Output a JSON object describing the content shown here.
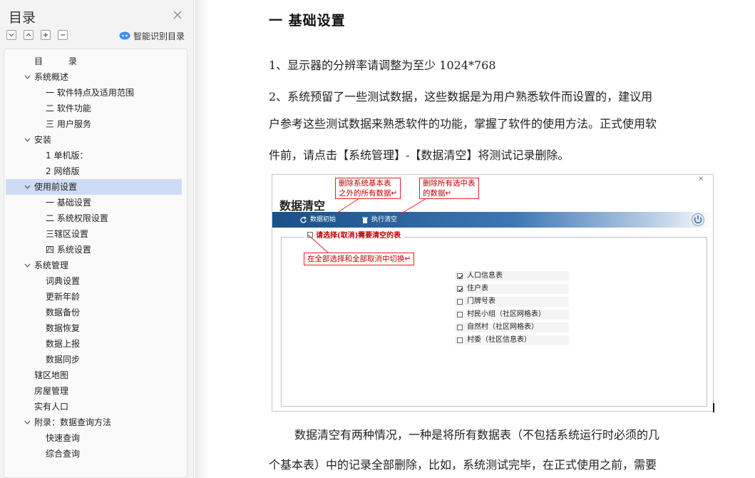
{
  "sidebar": {
    "title": "目录",
    "smart_toc_label": "智能识别目录",
    "items": [
      {
        "label": "目　　　录",
        "level": 0,
        "toggle": "none"
      },
      {
        "label": "系统概述",
        "level": 0,
        "toggle": "expanded"
      },
      {
        "label": "一  软件特点及适用范围",
        "level": 1,
        "toggle": "none"
      },
      {
        "label": "二  软件功能",
        "level": 1,
        "toggle": "none"
      },
      {
        "label": "三  用户服务",
        "level": 1,
        "toggle": "none"
      },
      {
        "label": "安装",
        "level": 0,
        "toggle": "expanded"
      },
      {
        "label": "1 单机版：",
        "level": 1,
        "toggle": "none"
      },
      {
        "label": "2  网络版",
        "level": 1,
        "toggle": "none"
      },
      {
        "label": "使用前设置",
        "level": 0,
        "toggle": "expanded",
        "selected": true
      },
      {
        "label": "一  基础设置",
        "level": 1,
        "toggle": "none"
      },
      {
        "label": "二  系统权限设置",
        "level": 1,
        "toggle": "none"
      },
      {
        "label": "三辖区设置",
        "level": 1,
        "toggle": "none"
      },
      {
        "label": "四  系统设置",
        "level": 1,
        "toggle": "none"
      },
      {
        "label": "系统管理",
        "level": 0,
        "toggle": "expanded"
      },
      {
        "label": "词典设置",
        "level": 1,
        "toggle": "none"
      },
      {
        "label": "更新年龄",
        "level": 1,
        "toggle": "none"
      },
      {
        "label": "数据备份",
        "level": 1,
        "toggle": "none"
      },
      {
        "label": "数据恢复",
        "level": 1,
        "toggle": "none"
      },
      {
        "label": "数据上报",
        "level": 1,
        "toggle": "none"
      },
      {
        "label": "数据同步",
        "level": 1,
        "toggle": "none"
      },
      {
        "label": "辖区地图",
        "level": 0,
        "toggle": "none"
      },
      {
        "label": "房屋管理",
        "level": 0,
        "toggle": "none"
      },
      {
        "label": "实有人口",
        "level": 0,
        "toggle": "none"
      },
      {
        "label": "附录：数据查询方法",
        "level": 0,
        "toggle": "expanded"
      },
      {
        "label": "快速查询",
        "level": 1,
        "toggle": "none"
      },
      {
        "label": "综合查询",
        "level": 1,
        "toggle": "none"
      }
    ]
  },
  "document": {
    "heading": "一  基础设置",
    "para1": "1、显示器的分辨率请调整为至少 1024*768",
    "para2_lines": [
      "2、系统预留了一些测试数据，这些数据是为用户熟悉软件而设置的，建议用",
      "户参考这些测试数据来熟悉软件的功能，掌握了软件的使用方法。正式使用软",
      "件前，请点击【系统管理】-【数据清空】将测试记录删除。"
    ],
    "para3_lines": [
      "数据清空有两种情况，一种是将所有数据表（不包括系统运行时必须的几",
      "个基本表）中的记录全部删除，比如，系统测试完毕，在正式使用之前，需要"
    ]
  },
  "figure": {
    "window_title": "数据清空",
    "toolbar_init": "数据初始",
    "toolbar_execute": "执行清空",
    "group_legend": "请选择(取消)需要清空的表",
    "callout_1": [
      "删除系统基本表",
      "之外的所有数据↵"
    ],
    "callout_2": [
      "删除所有选中表",
      "的数据↵"
    ],
    "callout_3": "在全部选择和全部取消中切换↵",
    "tables": [
      {
        "label": "人口信息表",
        "checked": true
      },
      {
        "label": "住户表",
        "checked": true
      },
      {
        "label": "门牌号表",
        "checked": false
      },
      {
        "label": "村民小组（社区网格表）",
        "checked": false
      },
      {
        "label": "自然村（社区网格表）",
        "checked": false
      },
      {
        "label": "村委（社区信息表）",
        "checked": false
      }
    ],
    "colors": {
      "callout_red": "#cc0000",
      "toolbar_blue": "#1a4f88"
    }
  }
}
